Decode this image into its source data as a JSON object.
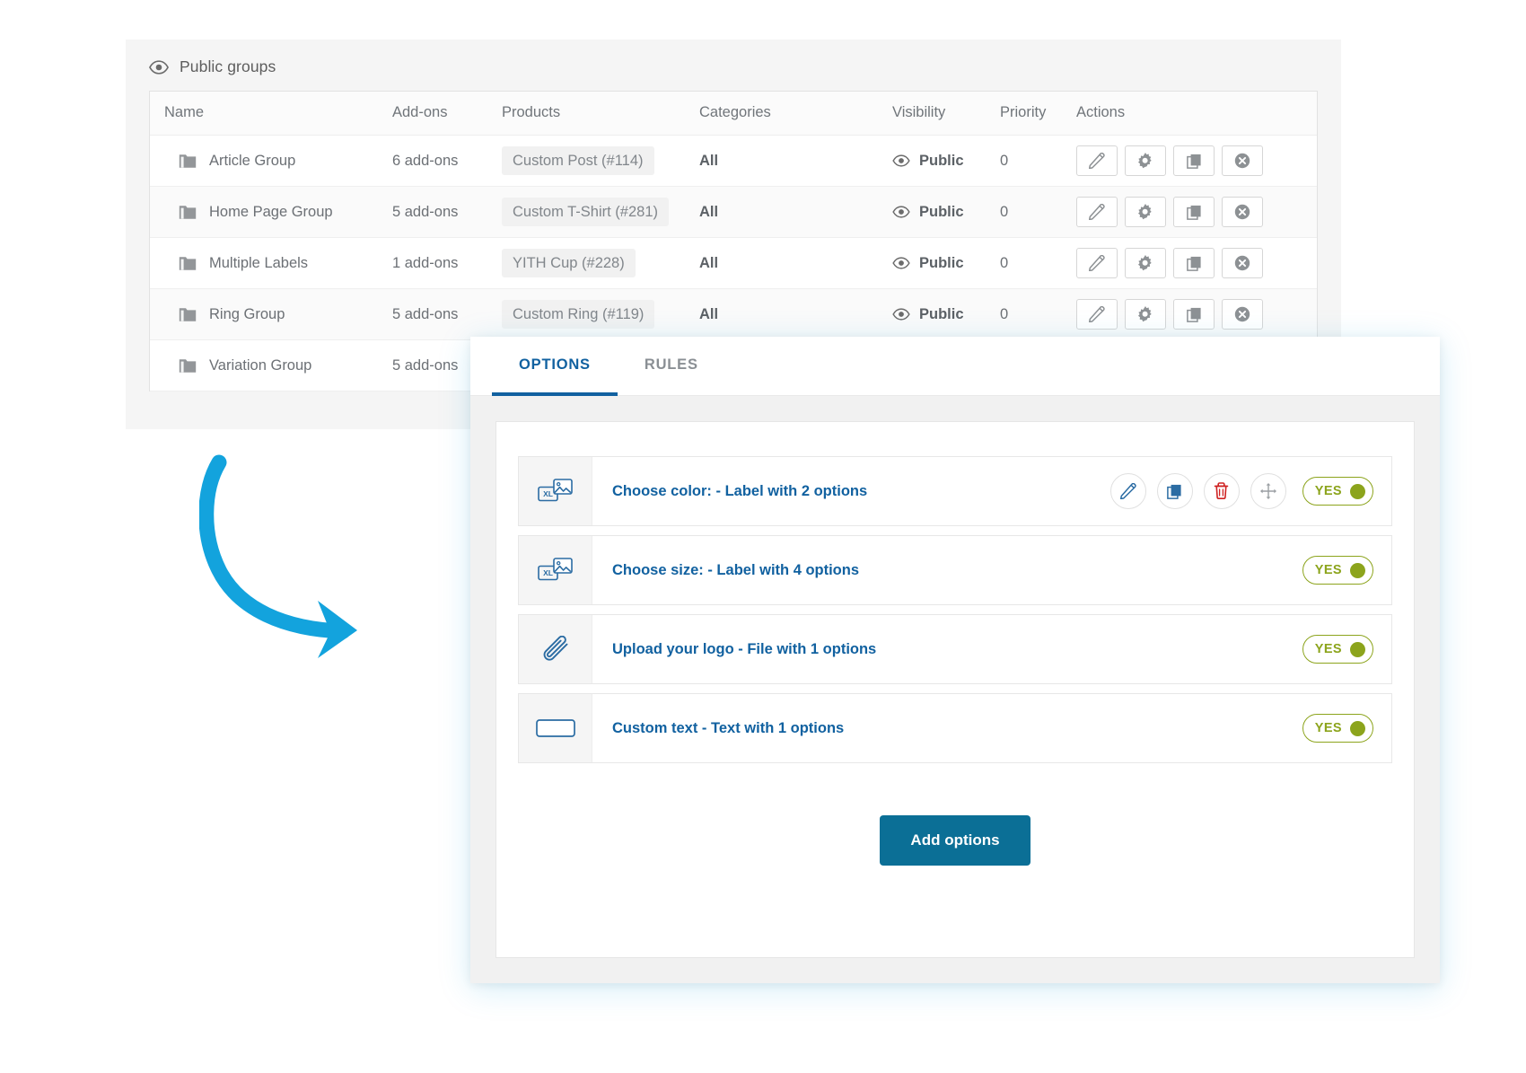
{
  "back_panel": {
    "header": {
      "icon": "eye-icon",
      "title": "Public groups"
    },
    "table": {
      "columns": [
        "Name",
        "Add-ons",
        "Products",
        "Categories",
        "Visibility",
        "Priority",
        "Actions"
      ],
      "rows": [
        {
          "name": "Article Group",
          "addons": "6 add-ons",
          "product": "Custom Post (#114)",
          "category": "All",
          "visibility": "Public",
          "priority": "0",
          "actions": [
            "edit-icon",
            "gear-icon",
            "duplicate-icon",
            "remove-icon"
          ]
        },
        {
          "name": "Home Page Group",
          "addons": "5 add-ons",
          "product": "Custom T-Shirt (#281)",
          "category": "All",
          "visibility": "Public",
          "priority": "0",
          "actions": [
            "edit-icon",
            "gear-icon",
            "duplicate-icon",
            "remove-icon"
          ]
        },
        {
          "name": "Multiple Labels",
          "addons": "1 add-ons",
          "product": "YITH Cup (#228)",
          "category": "All",
          "visibility": "Public",
          "priority": "0",
          "actions": [
            "edit-icon",
            "gear-icon",
            "duplicate-icon",
            "remove-icon"
          ]
        },
        {
          "name": "Ring Group",
          "addons": "5 add-ons",
          "product": "Custom Ring (#119)",
          "category": "All",
          "visibility": "Public",
          "priority": "0",
          "actions": [
            "edit-icon",
            "gear-icon",
            "duplicate-icon",
            "remove-icon"
          ]
        },
        {
          "name": "Variation Group",
          "addons": "5 add-ons",
          "product": "",
          "category": "",
          "visibility": "",
          "priority": "",
          "actions": []
        }
      ]
    }
  },
  "annotation": {
    "shape": "curved-arrow",
    "color": "#13a3dd"
  },
  "modal": {
    "tabs": [
      {
        "label": "OPTIONS",
        "active": true
      },
      {
        "label": "RULES",
        "active": false
      }
    ],
    "options": [
      {
        "icon": "label-image-icon",
        "icon_text": "XL",
        "label": "Choose color: - Label with 2 options",
        "toggle": "YES",
        "toggle_on": true,
        "actions": [
          "edit-icon",
          "duplicate-icon",
          "trash-icon",
          "move-icon"
        ],
        "show_actions": true
      },
      {
        "icon": "label-image-icon",
        "icon_text": "XL",
        "label": "Choose size: - Label with 4 options",
        "toggle": "YES",
        "toggle_on": true,
        "actions": [],
        "show_actions": false
      },
      {
        "icon": "paperclip-icon",
        "icon_text": "",
        "label": "Upload your logo - File with 1 options",
        "toggle": "YES",
        "toggle_on": true,
        "actions": [],
        "show_actions": false
      },
      {
        "icon": "text-field-icon",
        "icon_text": "",
        "label": "Custom text - Text with 1 options",
        "toggle": "YES",
        "toggle_on": true,
        "actions": [],
        "show_actions": false
      }
    ],
    "add_button": {
      "label": "Add options"
    }
  },
  "colors": {
    "accent_blue": "#1161a0",
    "button_teal": "#0b6f96",
    "toggle_green": "#8ca41c",
    "trash_red": "#cf2222",
    "arrow_cyan": "#13a3dd"
  }
}
